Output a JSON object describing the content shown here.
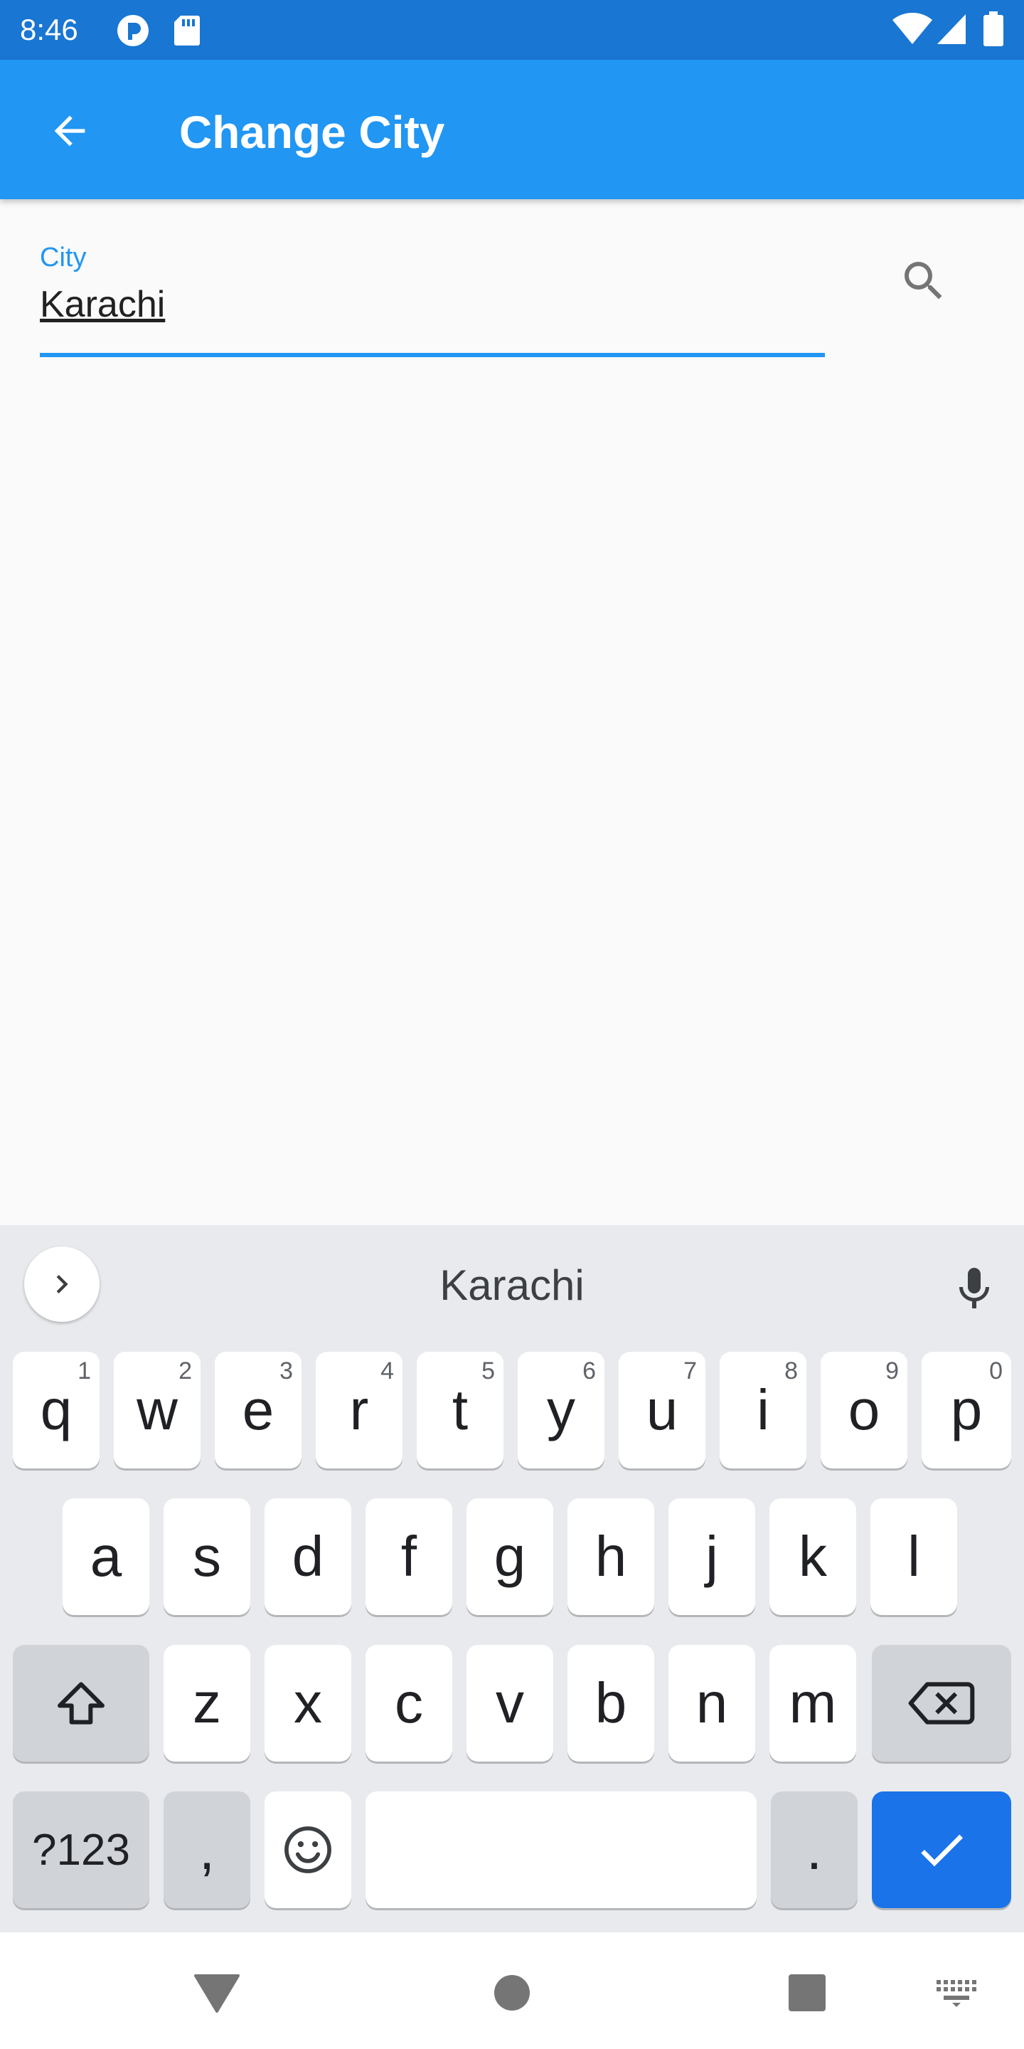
{
  "status_bar": {
    "time": "8:46",
    "icons": [
      "notification-app-icon",
      "sd-card-icon",
      "wifi-icon",
      "cell-signal-icon",
      "battery-icon"
    ]
  },
  "app_bar": {
    "title": "Change City",
    "back_icon": "arrow-left-icon",
    "color": "#2196f3"
  },
  "city_field": {
    "label": "City",
    "value": "Karachi",
    "accent_color": "#2196f3",
    "action_icon": "search-icon"
  },
  "keyboard": {
    "suggestion": "Karachi",
    "rows": [
      [
        {
          "label": "q",
          "hint": "1"
        },
        {
          "label": "w",
          "hint": "2"
        },
        {
          "label": "e",
          "hint": "3"
        },
        {
          "label": "r",
          "hint": "4"
        },
        {
          "label": "t",
          "hint": "5"
        },
        {
          "label": "y",
          "hint": "6"
        },
        {
          "label": "u",
          "hint": "7"
        },
        {
          "label": "i",
          "hint": "8"
        },
        {
          "label": "o",
          "hint": "9"
        },
        {
          "label": "p",
          "hint": "0"
        }
      ],
      [
        {
          "label": "a"
        },
        {
          "label": "s"
        },
        {
          "label": "d"
        },
        {
          "label": "f"
        },
        {
          "label": "g"
        },
        {
          "label": "h"
        },
        {
          "label": "j"
        },
        {
          "label": "k"
        },
        {
          "label": "l"
        }
      ],
      [
        {
          "label": "z"
        },
        {
          "label": "x"
        },
        {
          "label": "c"
        },
        {
          "label": "v"
        },
        {
          "label": "b"
        },
        {
          "label": "n"
        },
        {
          "label": "m"
        }
      ]
    ],
    "symbols_label": "?123",
    "comma_label": ",",
    "period_label": ".",
    "action_color": "#1a73e8"
  },
  "nav_bar": {
    "buttons": [
      "back-triangle-icon",
      "home-circle-icon",
      "recents-square-icon",
      "keyboard-switch-icon"
    ]
  }
}
